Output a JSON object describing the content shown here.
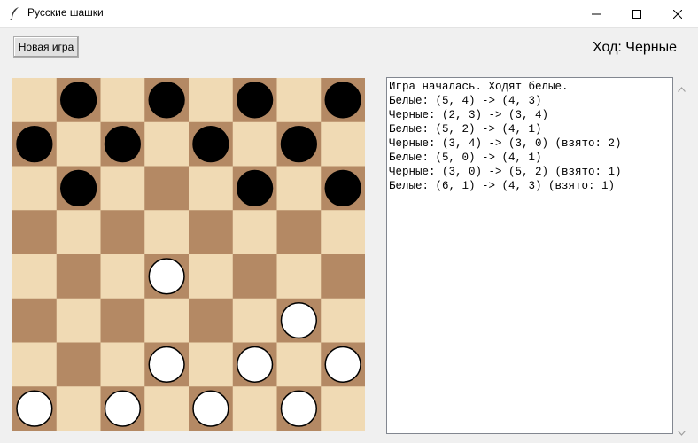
{
  "window": {
    "title": "Русские шашки",
    "icon": "feather-icon"
  },
  "toolbar": {
    "new_game_label": "Новая игра",
    "turn_label": "Ход: Черные"
  },
  "board": {
    "size": 8,
    "light_color": "#f0dab4",
    "dark_color": "#b48964",
    "black_piece_color": "#000000",
    "white_piece_color": "#ffffff",
    "pieces": [
      {
        "color": "black",
        "row": 0,
        "col": 1
      },
      {
        "color": "black",
        "row": 0,
        "col": 3
      },
      {
        "color": "black",
        "row": 0,
        "col": 5
      },
      {
        "color": "black",
        "row": 0,
        "col": 7
      },
      {
        "color": "black",
        "row": 1,
        "col": 0
      },
      {
        "color": "black",
        "row": 1,
        "col": 2
      },
      {
        "color": "black",
        "row": 1,
        "col": 4
      },
      {
        "color": "black",
        "row": 1,
        "col": 6
      },
      {
        "color": "black",
        "row": 2,
        "col": 1
      },
      {
        "color": "black",
        "row": 2,
        "col": 5
      },
      {
        "color": "black",
        "row": 2,
        "col": 7
      },
      {
        "color": "white",
        "row": 4,
        "col": 3
      },
      {
        "color": "white",
        "row": 5,
        "col": 6
      },
      {
        "color": "white",
        "row": 6,
        "col": 3
      },
      {
        "color": "white",
        "row": 6,
        "col": 5
      },
      {
        "color": "white",
        "row": 6,
        "col": 7
      },
      {
        "color": "white",
        "row": 7,
        "col": 0
      },
      {
        "color": "white",
        "row": 7,
        "col": 2
      },
      {
        "color": "white",
        "row": 7,
        "col": 4
      },
      {
        "color": "white",
        "row": 7,
        "col": 6
      }
    ]
  },
  "log": {
    "lines": [
      "Игра началась. Ходят белые.",
      "Белые: (5, 4) -> (4, 3)",
      "Черные: (2, 3) -> (3, 4)",
      "Белые: (5, 2) -> (4, 1)",
      "Черные: (3, 4) -> (3, 0) (взято: 2)",
      "Белые: (5, 0) -> (4, 1)",
      "Черные: (3, 0) -> (5, 2) (взято: 1)",
      "Белые: (6, 1) -> (4, 3) (взято: 1)"
    ]
  }
}
